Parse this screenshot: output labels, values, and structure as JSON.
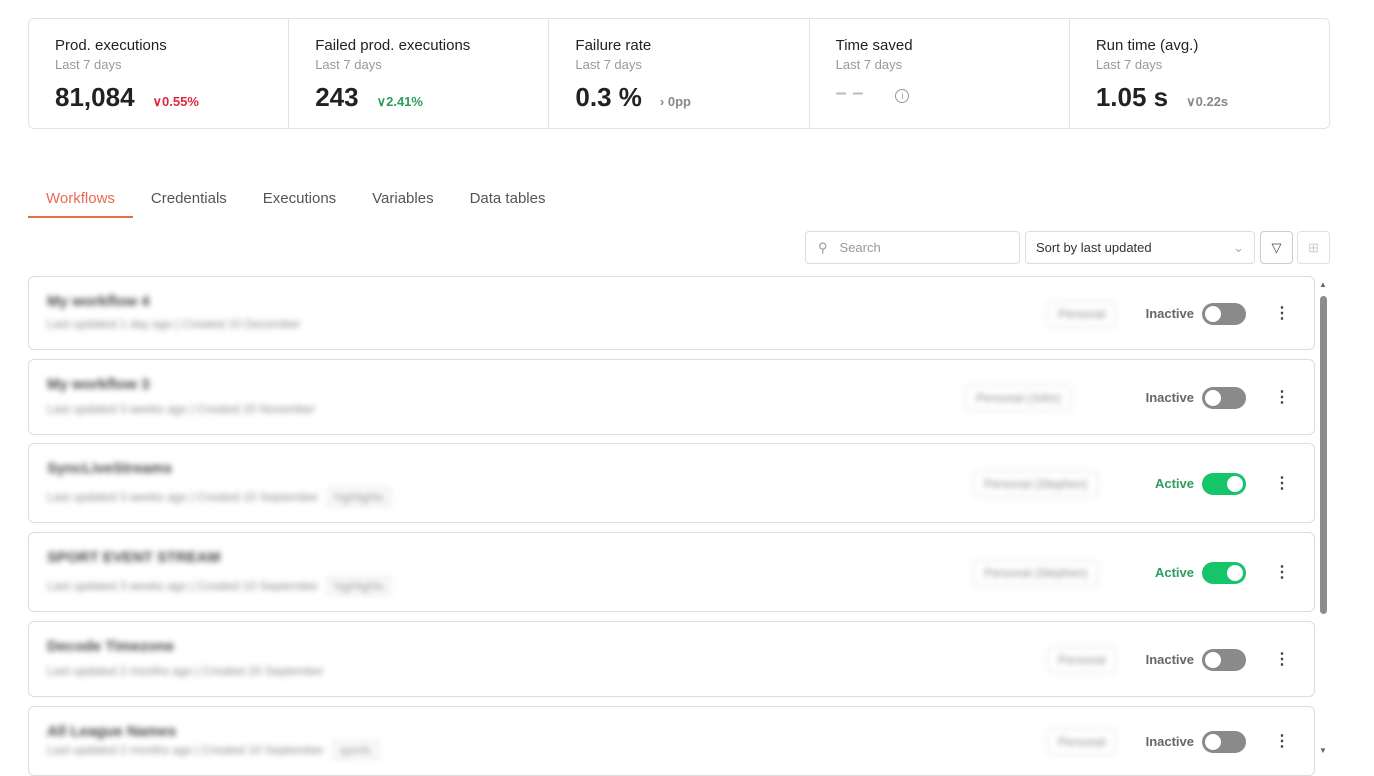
{
  "stats": [
    {
      "title": "Prod. executions",
      "sub": "Last 7 days",
      "value": "81,084",
      "delta": "∨0.55%",
      "tone": "red"
    },
    {
      "title": "Failed prod. executions",
      "sub": "Last 7 days",
      "value": "243",
      "delta": "∨2.41%",
      "tone": "green"
    },
    {
      "title": "Failure rate",
      "sub": "Last 7 days",
      "value": "0.3 %",
      "delta": "› 0pp",
      "tone": "grey"
    },
    {
      "title": "Time saved",
      "sub": "Last 7 days",
      "value": "– –",
      "delta": "i",
      "tone": "grey"
    },
    {
      "title": "Run time (avg.)",
      "sub": "Last 7 days",
      "value": "1.05 s",
      "delta": "∨0.22s",
      "tone": "grey"
    }
  ],
  "tabs": [
    "Workflows",
    "Credentials",
    "Executions",
    "Variables",
    "Data tables"
  ],
  "search": {
    "placeholder": "Search"
  },
  "sort": {
    "value": "Sort by last updated"
  },
  "workflows": [
    {
      "name": "My workflow 4",
      "sub": "Last updated 1 day ago | Created 10 December",
      "owner": "Personal",
      "status": "Inactive"
    },
    {
      "name": "My workflow 3",
      "sub": "Last updated 3 weeks ago | Created 20 November",
      "owner": "Personal (John)",
      "status": "Inactive"
    },
    {
      "name": "SyncLiveStreams",
      "sub": "Last updated 3 weeks ago | Created 10 September",
      "tag": "highlights",
      "owner": "Personal (Stephen)",
      "status": "Active"
    },
    {
      "name": "SPORT EVENT STREAM",
      "sub": "Last updated 3 weeks ago | Created 10 September",
      "tag": "highlights",
      "owner": "Personal (Stephen)",
      "status": "Active"
    },
    {
      "name": "Decode Timezone",
      "sub": "Last updated 2 months ago | Created 20 September",
      "owner": "Personal",
      "status": "Inactive"
    },
    {
      "name": "All League Names",
      "sub": "Last updated 2 months ago | Created 10 September",
      "tag": "sports",
      "owner": "Personal",
      "status": "Inactive"
    }
  ]
}
